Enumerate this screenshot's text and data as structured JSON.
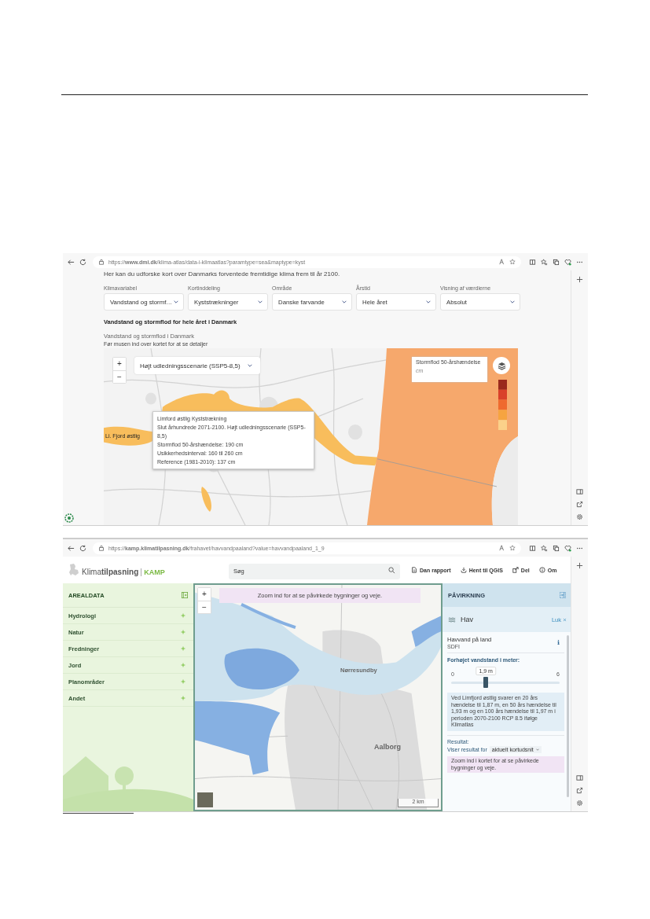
{
  "dmi_browser": {
    "url": "https://**www.dmi.dk**/klima-atlas/data-i-klimaatlas?paramtype=sea&maptype=kyst",
    "intro": "Her kan du udforske kort over Danmarks forventede fremtidige klima frem til år 2100.",
    "filters": [
      {
        "label": "Klimavariabel",
        "value": "Vandstand og stormf…"
      },
      {
        "label": "Kortinddeling",
        "value": "Kyststrækninger"
      },
      {
        "label": "Område",
        "value": "Danske farvande"
      },
      {
        "label": "Årstid",
        "value": "Hele året"
      },
      {
        "label": "Visning af værdierne",
        "value": "Absolut"
      }
    ],
    "section_title": "Vandstand og stormflod for hele året i Danmark",
    "map_title": "Vandstand og stormflod i Danmark",
    "map_hint": "Før musen ind over kortet for at se detaljer",
    "map": {
      "zoom_in": "+",
      "zoom_out": "−",
      "scenario": "Højt udledningsscenarie (SSP5-8,5)",
      "legend_title": "Stormflod 50-årshændelse",
      "legend_unit": "cm",
      "place_label": "Li. Fjord østlig",
      "tooltip": [
        "Limford østlig Kyststrækning",
        "Slut århundrede 2071-2100. Højt udledningsscenarie (SSP5-8,5)",
        "Stormflod 50-årshændelse: 190 cm",
        "Usikkerhedsinterval: 160 til 260 cm",
        "Reference (1981-2010): 137 cm"
      ]
    }
  },
  "kamp_browser": {
    "url": "https://**kamp.klimatilpasning.dk**/frahavet/havvandpaaland?value=havvandpaaland_1_9",
    "logo": "Klima**tilpasning**",
    "logo_product": "KAMP",
    "search": {
      "placeholder": "Søg"
    },
    "actions": [
      {
        "kind": "report",
        "label": "Dan rapport"
      },
      {
        "kind": "download",
        "label": "Hent til QGIS"
      },
      {
        "kind": "share",
        "label": "Del"
      },
      {
        "kind": "info",
        "label": "Om"
      }
    ],
    "left_panel": {
      "title": "AREALDATA",
      "items": [
        {
          "label": "Hydrologi",
          "expanded": false
        },
        {
          "label": "Natur",
          "expanded": false
        },
        {
          "label": "Fredninger",
          "expanded": false
        },
        {
          "label": "Jord",
          "expanded": false
        },
        {
          "label": "Planområder",
          "expanded": false
        },
        {
          "label": "Andet",
          "expanded": false
        }
      ]
    },
    "map": {
      "zoom_in": "+",
      "zoom_out": "−",
      "notice": "Zoom ind for at se påvirkede bygninger og veje.",
      "labels": [
        "Nørresundby",
        "Aalborg"
      ],
      "scale": "2 km"
    },
    "right_panel": {
      "title": "PÅVIRKNING",
      "section": "Hav",
      "close_label": "Luk",
      "layer_title": "Havvand på land",
      "layer_source": "SDFI",
      "info_mark": "i",
      "slider": {
        "label": "Forhøjet vandstand i meter:",
        "min": "0",
        "max": "6",
        "value": "1,9 m",
        "level": 0.32
      },
      "note": "Ved Limfjord østlig svarer en 20 års hændelse til 1,87 m, en 50 års hændelse til 1,93 m og en 100 års hændelse til 1,97 m i perioden 2070-2100 RCP 8.5 ifølge Klimatlas",
      "result_label": "Resultat:",
      "result_prefix": "Viser resultat for",
      "result_select": "aktuelt kortudsnit",
      "result_notice": "Zoom ind i kortet for at se påvirkede bygninger og veje."
    }
  }
}
